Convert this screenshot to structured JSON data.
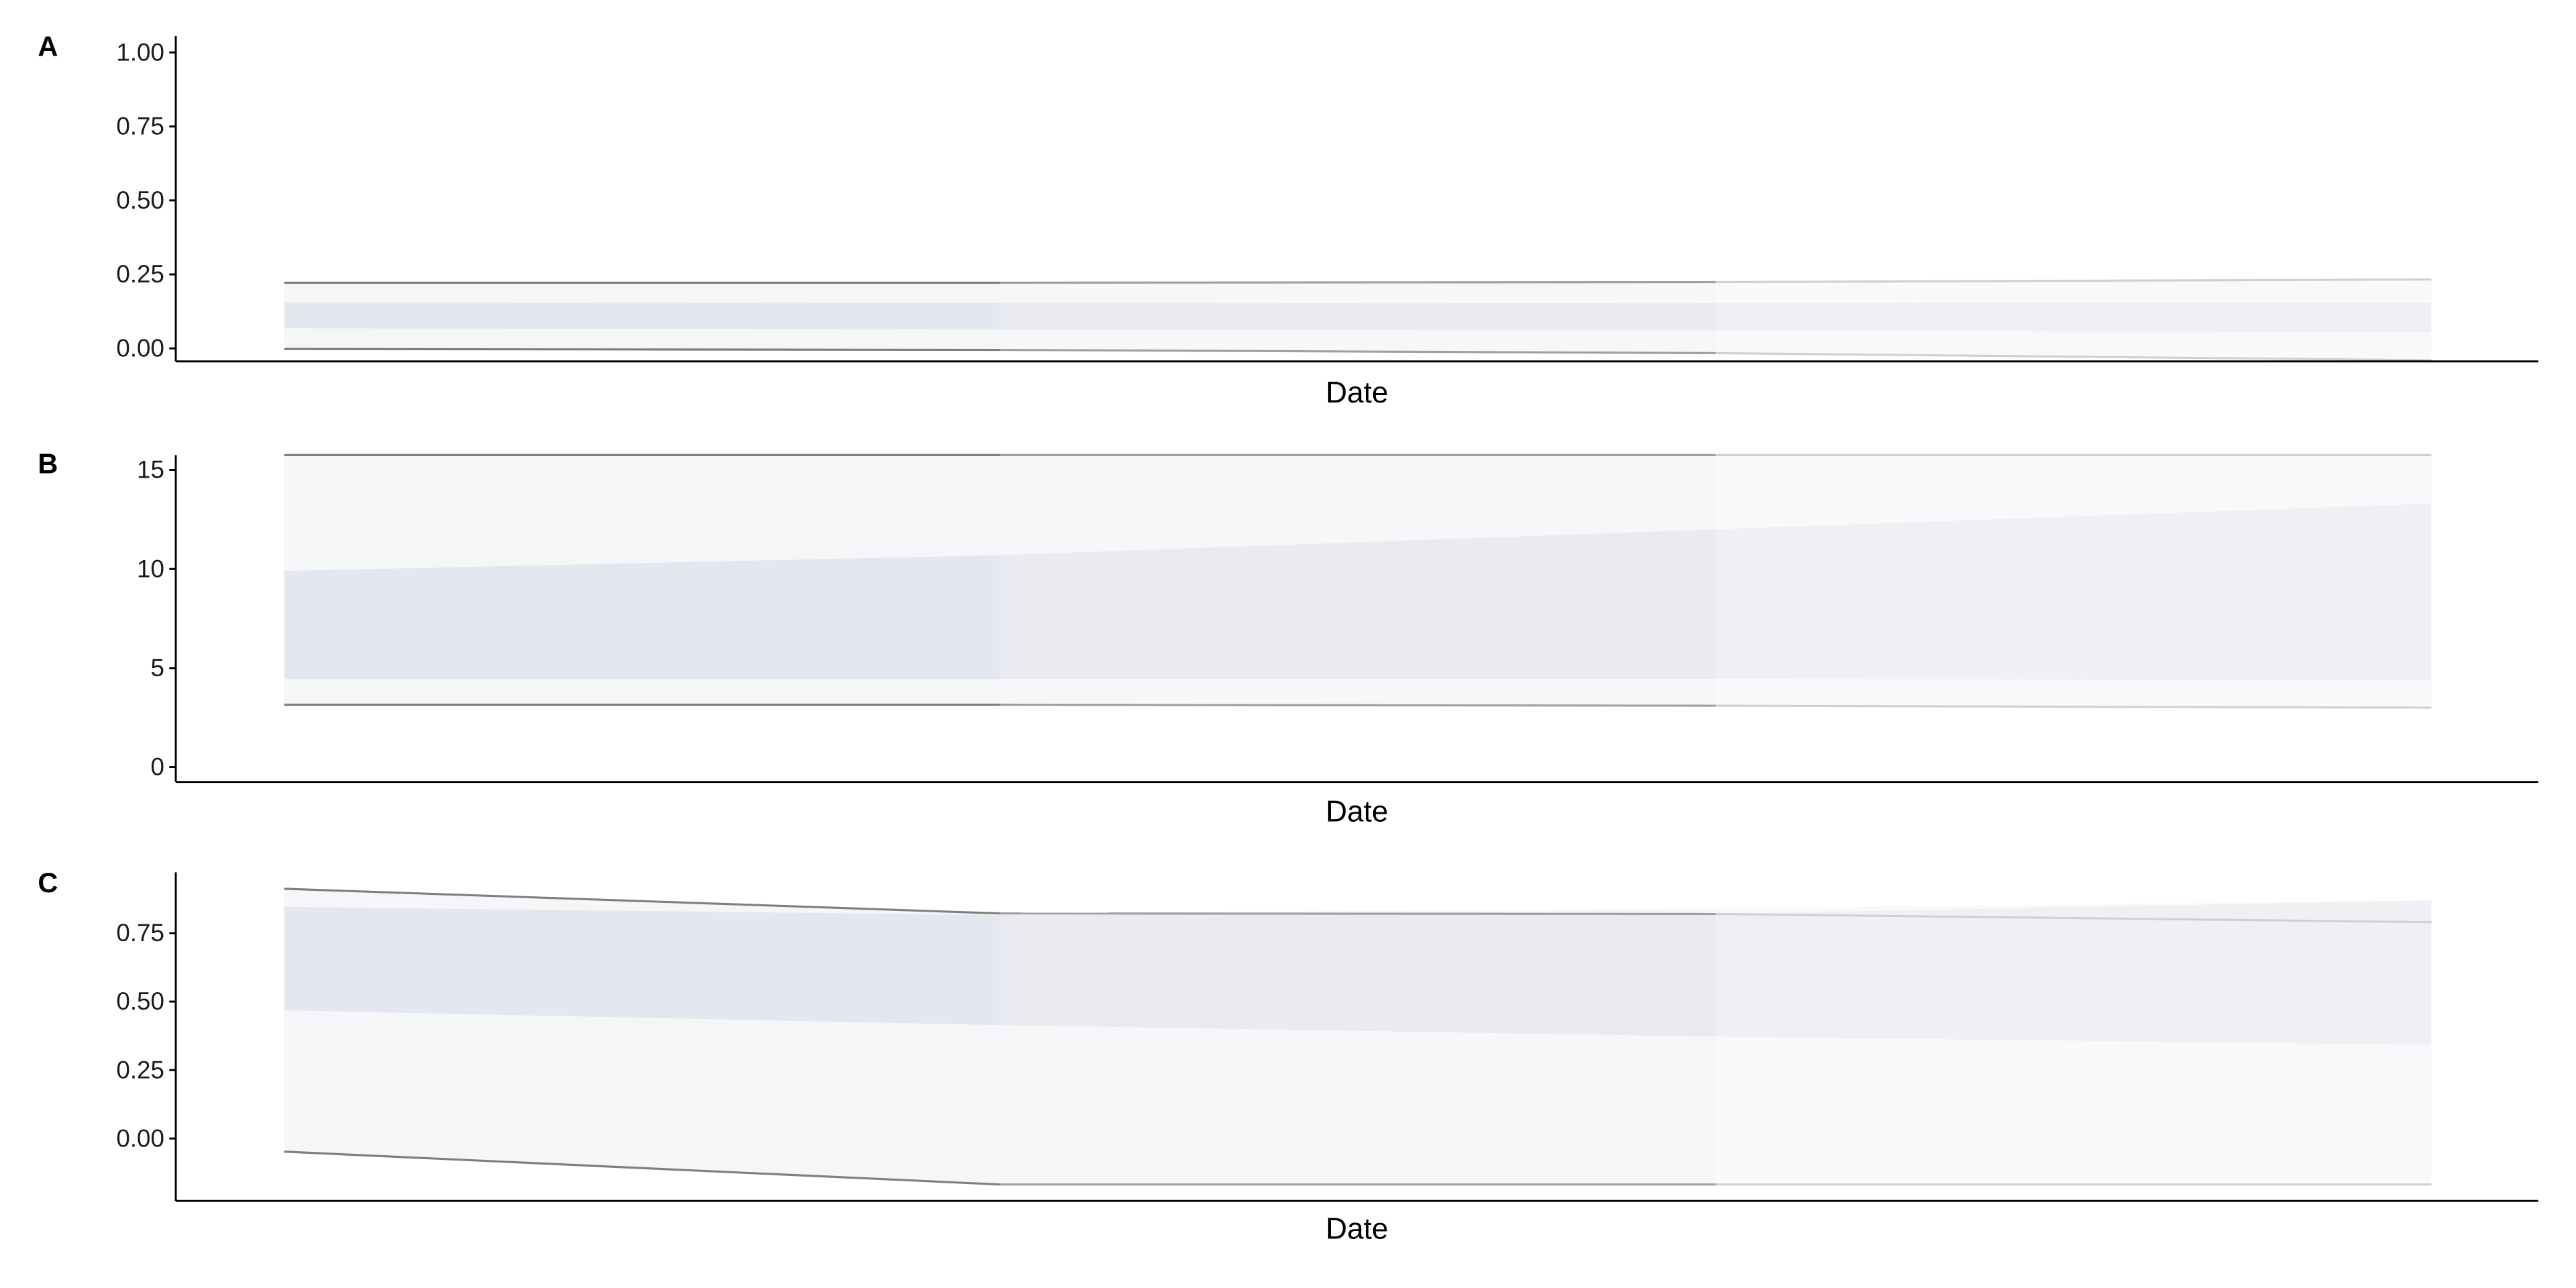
{
  "colors": {
    "inner_band": [
      "#e4e7ef",
      "#eaebf0",
      "#eef0f4"
    ],
    "outer_band": [
      "#f5f6f8",
      "#f6f7f9",
      "#f9f9fb"
    ],
    "lines": [
      "#7f7f7f",
      "#a0a0a0",
      "#d0d0d0"
    ],
    "axis": "#000000"
  },
  "chart_data": [
    {
      "type": "area",
      "panel_label": "A",
      "xlabel": "Date",
      "ylabel": "",
      "ylim": [
        -0.044,
        1.055
      ],
      "yticks": [
        0,
        0.25,
        0.5,
        0.75,
        1
      ],
      "ytick_labels": [
        "0.00",
        "0.25",
        "0.50",
        "0.75",
        "1.00"
      ],
      "grid": false,
      "upper_line": [
        0.222,
        0.222,
        0.224,
        0.233
      ],
      "lower_line": [
        -0.002,
        -0.005,
        -0.016,
        -0.04
      ],
      "outer_band": {
        "upper": [
          0.222,
          0.222,
          0.224,
          0.233
        ],
        "lower": [
          -0.002,
          -0.005,
          -0.016,
          -0.04
        ]
      },
      "inner_band": {
        "upper": [
          0.155,
          0.154,
          0.153,
          0.155
        ],
        "lower": [
          0.068,
          0.064,
          0.06,
          0.055
        ]
      }
    },
    {
      "type": "area",
      "panel_label": "B",
      "xlabel": "Date",
      "ylabel": "",
      "ylim": [
        -0.75,
        15.75
      ],
      "yticks": [
        0,
        5,
        10,
        15
      ],
      "ytick_labels": [
        "0",
        "5",
        "10",
        "15"
      ],
      "grid": false,
      "upper_line": [
        15.75,
        15.75,
        15.75,
        15.75
      ],
      "lower_line": [
        3.15,
        3.15,
        3.1,
        3.0
      ],
      "outer_band": {
        "upper": [
          15.75,
          15.75,
          15.75,
          15.75
        ],
        "lower": [
          3.15,
          3.15,
          3.1,
          3.0
        ]
      },
      "inner_band": {
        "upper": [
          9.9,
          10.7,
          12.0,
          13.3
        ],
        "lower": [
          4.45,
          4.45,
          4.45,
          4.4
        ]
      }
    },
    {
      "type": "area",
      "panel_label": "C",
      "xlabel": "Date",
      "ylabel": "",
      "ylim": [
        -0.228,
        0.972
      ],
      "yticks": [
        0,
        0.25,
        0.5,
        0.75
      ],
      "ytick_labels": [
        "0.00",
        "0.25",
        "0.50",
        "0.75"
      ],
      "grid": false,
      "upper_line": [
        0.912,
        0.822,
        0.82,
        0.79
      ],
      "lower_line": [
        -0.048,
        -0.168,
        -0.168,
        -0.168
      ],
      "outer_band": {
        "upper": [
          0.912,
          0.822,
          0.84,
          0.87
        ],
        "lower": [
          -0.048,
          -0.168,
          -0.168,
          -0.168
        ]
      },
      "inner_band": {
        "upper": [
          0.846,
          0.816,
          0.82,
          0.87
        ],
        "lower": [
          0.468,
          0.414,
          0.372,
          0.342
        ]
      }
    }
  ]
}
